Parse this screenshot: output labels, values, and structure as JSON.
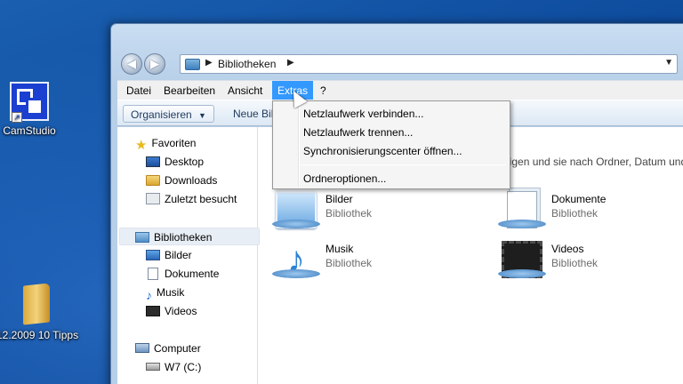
{
  "desktop": {
    "icons": [
      {
        "label": "CamStudio"
      },
      {
        "label": "12.2009 10 Tipps"
      }
    ]
  },
  "window": {
    "address": {
      "path": "Bibliotheken"
    },
    "menubar": {
      "items": [
        {
          "label": "Datei"
        },
        {
          "label": "Bearbeiten"
        },
        {
          "label": "Ansicht"
        },
        {
          "label": "Extras"
        },
        {
          "label": "?"
        }
      ],
      "active": "Extras"
    },
    "toolbar": {
      "organize_label": "Organisieren",
      "new_library_label": "Neue Bib"
    },
    "navpane": {
      "favorites_header": "Favoriten",
      "favorites": [
        {
          "label": "Desktop",
          "icon": "desktop-icon"
        },
        {
          "label": "Downloads",
          "icon": "folder-icon"
        },
        {
          "label": "Zuletzt besucht",
          "icon": "recent-icon"
        }
      ],
      "libraries_header": "Bibliotheken",
      "libraries": [
        {
          "label": "Bilder",
          "icon": "pictures-icon"
        },
        {
          "label": "Dokumente",
          "icon": "documents-icon"
        },
        {
          "label": "Musik",
          "icon": "music-icon"
        },
        {
          "label": "Videos",
          "icon": "videos-icon"
        }
      ],
      "computer_header": "Computer",
      "drives": [
        {
          "label": "W7 (C:)"
        }
      ]
    },
    "main": {
      "hint_text": "eigen und sie nach Ordner, Datum und",
      "libraries": [
        {
          "name": "Bilder",
          "type": "Bibliothek"
        },
        {
          "name": "Dokumente",
          "type": "Bibliothek"
        },
        {
          "name": "Musik",
          "type": "Bibliothek"
        },
        {
          "name": "Videos",
          "type": "Bibliothek"
        }
      ]
    },
    "extras_menu": {
      "items": [
        {
          "label": "Netzlaufwerk verbinden..."
        },
        {
          "label": "Netzlaufwerk trennen..."
        },
        {
          "label": "Synchronisierungscenter öffnen..."
        },
        {
          "label": "Ordneroptionen..."
        }
      ]
    }
  },
  "colors": {
    "menu_highlight": "#3399ff",
    "desktop": "#0d4a9c"
  }
}
